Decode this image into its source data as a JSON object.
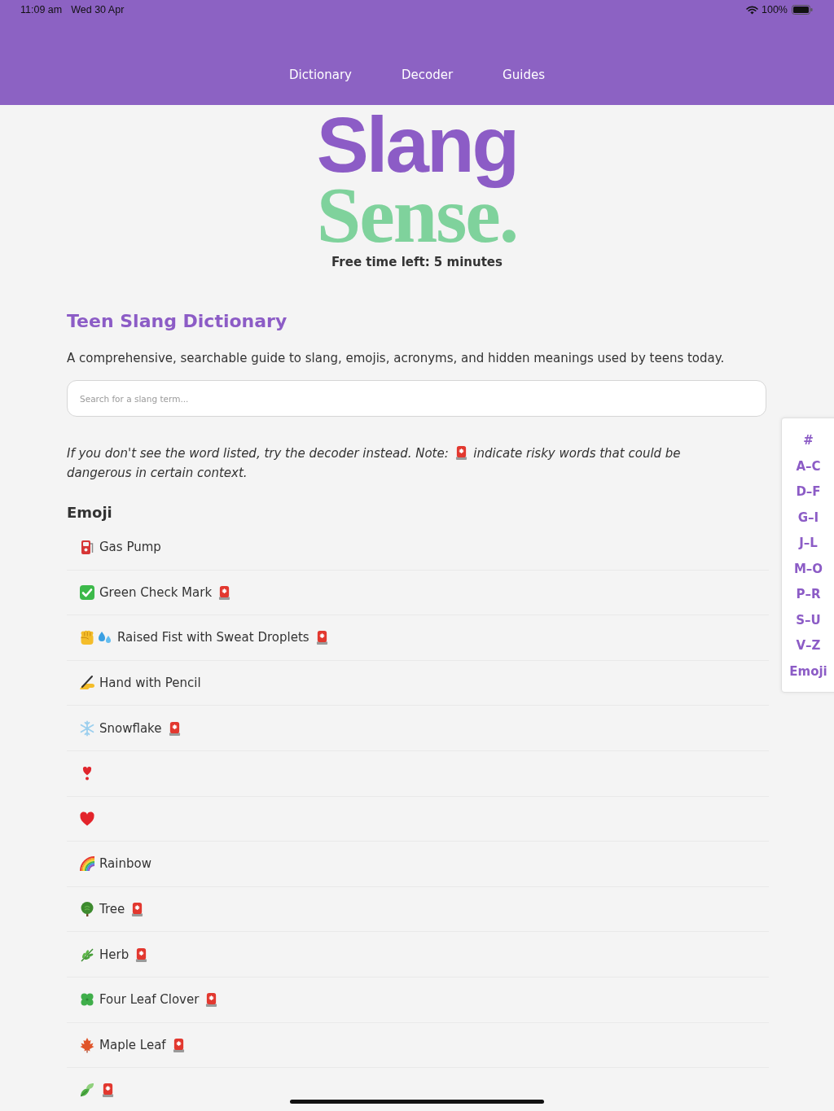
{
  "status_bar": {
    "time": "11:09 am",
    "date": "Wed 30 Apr",
    "battery": "100%"
  },
  "nav": {
    "links": [
      "Dictionary",
      "Decoder",
      "Guides"
    ]
  },
  "logo": {
    "line_1": "Slang",
    "line_2": "Sense."
  },
  "free_time": "Free time left: 5 minutes",
  "title": "Teen Slang Dictionary",
  "description": "A comprehensive, searchable guide to slang, emojis, acronyms, and hidden meanings used by teens today.",
  "search": {
    "placeholder": "Search for a slang term..."
  },
  "note": {
    "before": "If you don't see the word listed, try the decoder instead. Note:",
    "after": "indicate risky words that could be dangerous in certain context."
  },
  "section": {
    "heading": "Emoji",
    "entries": [
      {
        "kind": "pump",
        "label": "Gas Pump",
        "risky": false
      },
      {
        "kind": "check",
        "label": "Green Check Mark",
        "risky": true
      },
      {
        "kind": "fistdroplets",
        "label": "Raised Fist with Sweat Droplets",
        "risky": true
      },
      {
        "kind": "hand",
        "label": "Hand with Pencil",
        "risky": false
      },
      {
        "kind": "snowflake",
        "label": "Snowflake",
        "risky": true
      },
      {
        "kind": "heartexclamation",
        "risky": false
      },
      {
        "kind": "heart",
        "risky": false
      },
      {
        "kind": "rainbow",
        "label": "Rainbow",
        "risky": false
      },
      {
        "kind": "tree",
        "label": "Tree",
        "risky": true
      },
      {
        "kind": "herb",
        "label": "Herb",
        "risky": true
      },
      {
        "kind": "clover",
        "label": "Four Leaf Clover",
        "risky": true
      },
      {
        "kind": "maple",
        "label": "Maple Leaf",
        "risky": true
      },
      {
        "kind": "leaf",
        "risky": true
      }
    ]
  },
  "index": [
    "#",
    "A–C",
    "D–F",
    "G–I",
    "J–L",
    "M–O",
    "P–R",
    "S–U",
    "V–Z",
    "Emoji"
  ]
}
